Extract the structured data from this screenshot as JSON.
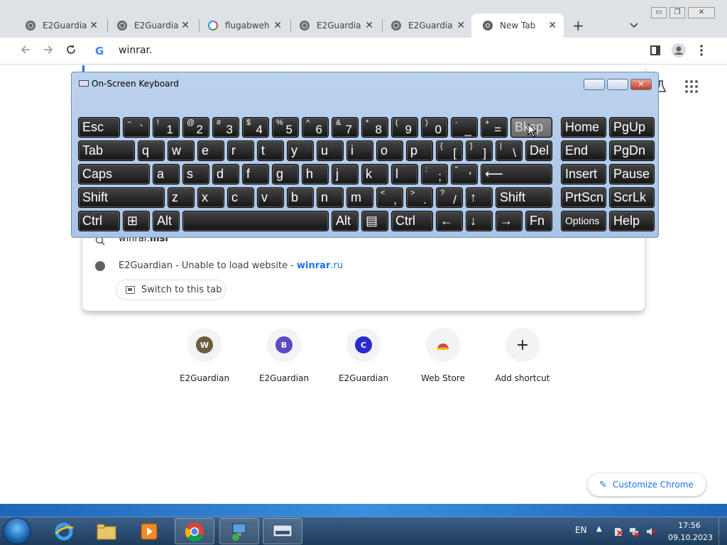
{
  "browser": {
    "tabs": [
      {
        "label": "E2Guardian",
        "icon": "globe-icon"
      },
      {
        "label": "E2Guardian",
        "icon": "globe-icon"
      },
      {
        "label": "flugabwehr",
        "icon": "google-icon"
      },
      {
        "label": "E2Guardian",
        "icon": "globe-icon"
      },
      {
        "label": "E2Guardian",
        "icon": "globe-icon"
      },
      {
        "label": "New Tab",
        "icon": "chrome-icon",
        "active": true
      }
    ],
    "new_tab_glyph": "+",
    "tab_close_glyph": "✕",
    "omnibox_value": "winrar.",
    "window_controls": [
      "▭",
      "❐",
      "✕"
    ]
  },
  "omnibox_dropdown": {
    "suggestion_1": {
      "text_plain": "winrar.",
      "text_bold": "msi"
    },
    "suggestion_2": {
      "title": "E2Guardian - Unable to load website - ",
      "domain_bold": "winrar",
      "domain_rest": ".ru"
    },
    "switch_button": "Switch to this tab"
  },
  "shortcuts": [
    {
      "letter": "W",
      "label": "E2Guardian",
      "color": "#6d5d3c"
    },
    {
      "letter": "B",
      "label": "E2Guardian",
      "color": "#5b4bc4"
    },
    {
      "letter": "C",
      "label": "E2Guardian",
      "color": "#2a2ad0"
    },
    {
      "letter": "",
      "label": "Web Store",
      "color": "#f1f3f4"
    },
    {
      "letter": "+",
      "label": "Add shortcut",
      "color": "#f1f3f4"
    }
  ],
  "customize_label": "Customize Chrome",
  "osk": {
    "title": "On-Screen Keyboard",
    "rows": [
      [
        {
          "m": "Esc"
        },
        {
          "s": "~",
          "l": "`"
        },
        {
          "s": "!",
          "l": "1"
        },
        {
          "s": "@",
          "l": "2"
        },
        {
          "s": "#",
          "l": "3"
        },
        {
          "s": "$",
          "l": "4"
        },
        {
          "s": "%",
          "l": "5"
        },
        {
          "s": "^",
          "l": "6"
        },
        {
          "s": "&",
          "l": "7"
        },
        {
          "s": "*",
          "l": "8"
        },
        {
          "s": "(",
          "l": "9"
        },
        {
          "s": ")",
          "l": "0"
        },
        {
          "s": "-",
          "l": "_"
        },
        {
          "s": "+",
          "l": "="
        },
        {
          "m": "Bksp"
        },
        {
          "m": "Home"
        },
        {
          "m": "PgUp"
        }
      ],
      [
        {
          "m": "Tab"
        },
        {
          "m": "q"
        },
        {
          "m": "w"
        },
        {
          "m": "e"
        },
        {
          "m": "r"
        },
        {
          "m": "t"
        },
        {
          "m": "y"
        },
        {
          "m": "u"
        },
        {
          "m": "i"
        },
        {
          "m": "o"
        },
        {
          "m": "p"
        },
        {
          "s": "{",
          "l": "["
        },
        {
          "s": "}",
          "l": "]"
        },
        {
          "s": "|",
          "l": "\\"
        },
        {
          "m": "Del"
        },
        {
          "m": "End"
        },
        {
          "m": "PgDn"
        }
      ],
      [
        {
          "m": "Caps"
        },
        {
          "m": "a"
        },
        {
          "m": "s"
        },
        {
          "m": "d"
        },
        {
          "m": "f"
        },
        {
          "m": "g"
        },
        {
          "m": "h"
        },
        {
          "m": "j"
        },
        {
          "m": "k"
        },
        {
          "m": "l"
        },
        {
          "s": ":",
          "l": ";"
        },
        {
          "s": "\"",
          "l": "'"
        },
        {
          "m": "⟵"
        },
        {
          "m": "Insert"
        },
        {
          "m": "Pause"
        }
      ],
      [
        {
          "m": "Shift"
        },
        {
          "m": "z"
        },
        {
          "m": "x"
        },
        {
          "m": "c"
        },
        {
          "m": "v"
        },
        {
          "m": "b"
        },
        {
          "m": "n"
        },
        {
          "m": "m"
        },
        {
          "s": "<",
          "l": ","
        },
        {
          "s": ">",
          "l": "."
        },
        {
          "s": "?",
          "l": "/"
        },
        {
          "m": "↑"
        },
        {
          "m": "Shift"
        },
        {
          "m": "PrtScn"
        },
        {
          "m": "ScrLk"
        }
      ],
      [
        {
          "m": "Ctrl"
        },
        {
          "m": "⊞"
        },
        {
          "m": "Alt"
        },
        {
          "m": ""
        },
        {
          "m": "Alt"
        },
        {
          "m": "▤"
        },
        {
          "m": "Ctrl"
        },
        {
          "m": "←"
        },
        {
          "m": "↓"
        },
        {
          "m": "→"
        },
        {
          "m": "Fn"
        },
        {
          "m": "Options"
        },
        {
          "m": "Help"
        }
      ]
    ]
  },
  "taskbar": {
    "language": "EN",
    "tray_arrow": "▲",
    "time": "17:56",
    "date": "09.10.2023"
  }
}
